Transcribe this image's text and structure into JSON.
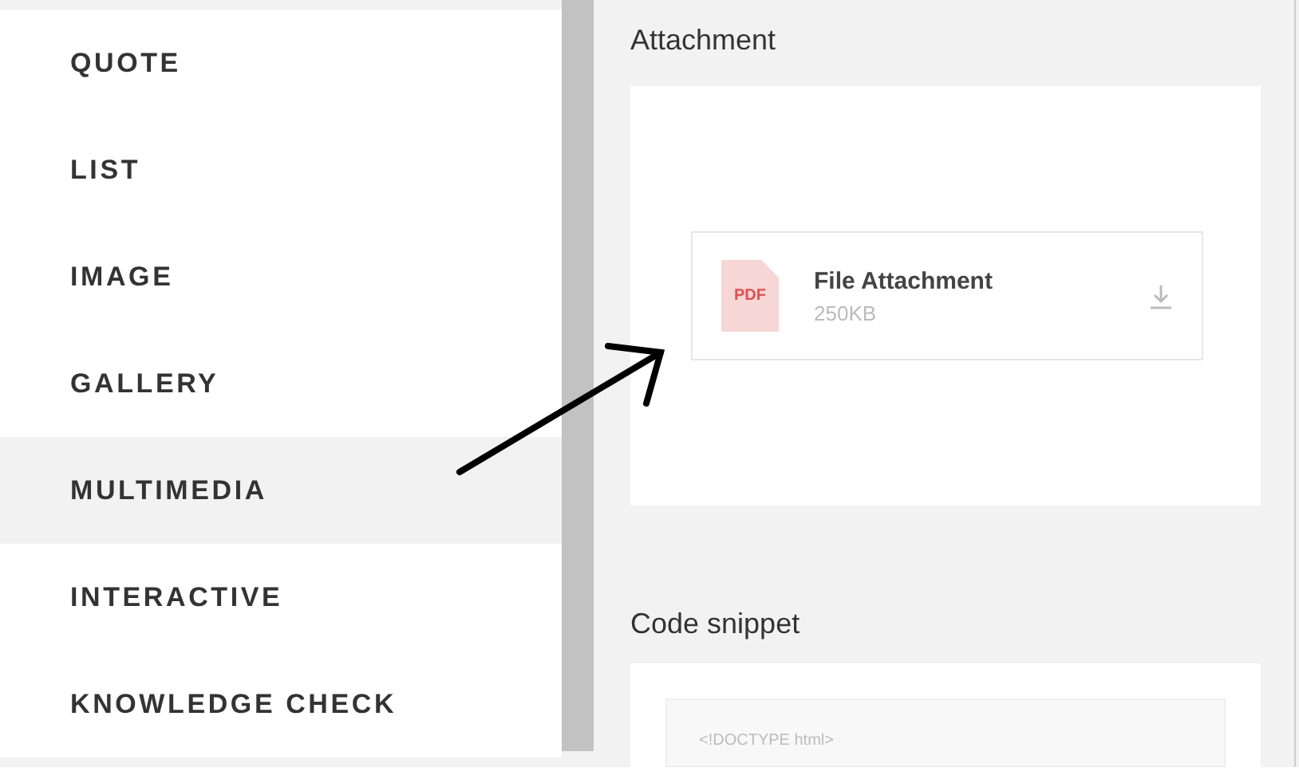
{
  "sidebar": {
    "items": [
      {
        "label": "QUOTE",
        "selected": false
      },
      {
        "label": "LIST",
        "selected": false
      },
      {
        "label": "IMAGE",
        "selected": false
      },
      {
        "label": "GALLERY",
        "selected": false
      },
      {
        "label": "MULTIMEDIA",
        "selected": true
      },
      {
        "label": "INTERACTIVE",
        "selected": false
      },
      {
        "label": "KNOWLEDGE CHECK",
        "selected": false
      }
    ]
  },
  "sections": [
    {
      "kind": "attachment",
      "title": "Attachment",
      "file": {
        "badge": "PDF",
        "name": "File Attachment",
        "size": "250KB"
      }
    },
    {
      "kind": "code",
      "title": "Code snippet",
      "code": "<!DOCTYPE html>"
    }
  ]
}
